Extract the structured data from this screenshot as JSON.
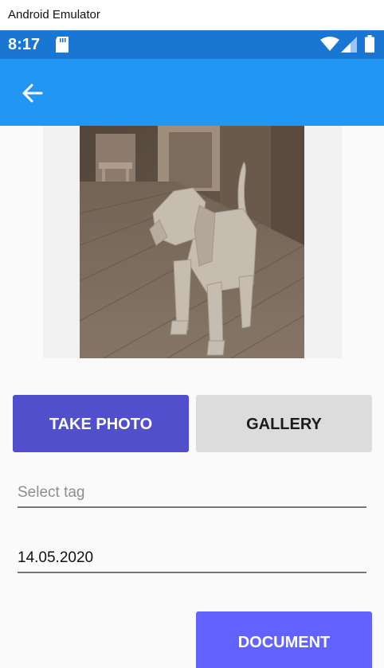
{
  "window": {
    "title": "Android Emulator"
  },
  "statusbar": {
    "time": "8:17"
  },
  "appbar": {
    "back_icon": "arrow-left-icon"
  },
  "photo": {
    "subject": "dog-photo"
  },
  "buttons": {
    "take_photo": "TAKE PHOTO",
    "gallery": "GALLERY",
    "document": "DOCUMENT"
  },
  "form": {
    "tag_placeholder": "Select tag",
    "date_value": "14.05.2020"
  },
  "colors": {
    "statusbar": "#1976d2",
    "appbar": "#2196f3",
    "take_photo_bg": "#514fcb",
    "gallery_bg": "#dcdcdc",
    "document_bg": "#6262ff"
  }
}
